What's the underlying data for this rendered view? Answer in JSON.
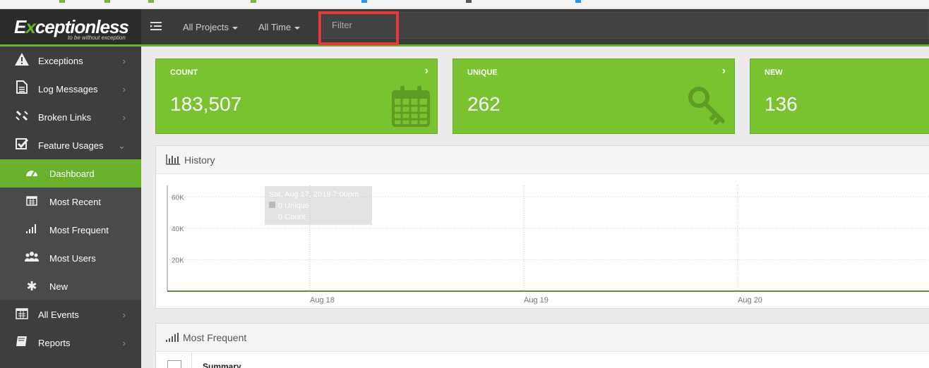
{
  "header": {
    "logo": "Exceptionless",
    "tagline": "to be without exception",
    "project_filter": "All Projects",
    "time_filter": "All Time",
    "filter_placeholder": "Filter"
  },
  "sidebar": {
    "items": [
      {
        "label": "Exceptions",
        "icon": "warning-icon"
      },
      {
        "label": "Log Messages",
        "icon": "file-text-icon"
      },
      {
        "label": "Broken Links",
        "icon": "unlink-icon"
      },
      {
        "label": "Feature Usages",
        "icon": "check-square-icon"
      }
    ],
    "sub_items": [
      {
        "label": "Dashboard",
        "icon": "tachometer-icon",
        "active": true
      },
      {
        "label": "Most Recent",
        "icon": "calendar-icon"
      },
      {
        "label": "Most Frequent",
        "icon": "signal-icon"
      },
      {
        "label": "Most Users",
        "icon": "users-icon"
      },
      {
        "label": "New",
        "icon": "asterisk-icon"
      }
    ],
    "bottom_items": [
      {
        "label": "All Events",
        "icon": "calendar-icon"
      },
      {
        "label": "Reports",
        "icon": "book-icon"
      }
    ]
  },
  "stats": [
    {
      "label": "COUNT",
      "value": "183,507",
      "icon": "calendar-icon"
    },
    {
      "label": "UNIQUE",
      "value": "262",
      "icon": "key-icon"
    },
    {
      "label": "NEW",
      "value": "136"
    }
  ],
  "history": {
    "title": "History",
    "tooltip": {
      "date": "Sat, Aug 17, 2019 7:00pm",
      "unique": "0 Unique",
      "count": "0 Count"
    }
  },
  "chart_data": {
    "type": "area",
    "title": "History",
    "x": [
      "Aug 18",
      "Aug 19",
      "Aug 20"
    ],
    "ylim": [
      0,
      70000
    ],
    "yticks": [
      "20K",
      "40K",
      "60K"
    ],
    "series": [
      {
        "name": "Unique",
        "values": [
          0,
          0,
          0
        ]
      },
      {
        "name": "Count",
        "values": [
          0,
          0,
          0
        ]
      }
    ],
    "grid": true
  },
  "most_frequent": {
    "title": "Most Frequent",
    "columns": [
      "Summary"
    ]
  },
  "colors": {
    "accent": "#6ab22c",
    "card": "#7ac330",
    "header": "#3a3a3a",
    "sidebar": "#3e3e3e",
    "highlight": "#e8383d"
  }
}
